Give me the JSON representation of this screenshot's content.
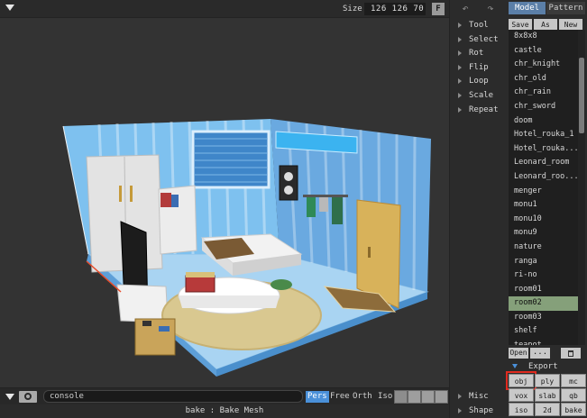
{
  "toolbar": {
    "size_label": "Size",
    "size_values": "126 126 70",
    "f_button": "F"
  },
  "tools": {
    "undo_icon": "undo-icon",
    "redo_icon": "redo-icon",
    "items": [
      "Tool",
      "Select",
      "Rot",
      "Flip",
      "Loop",
      "Scale",
      "Repeat",
      "Misc",
      "Shape"
    ]
  },
  "tabs": {
    "model": "Model",
    "pattern": "Pattern"
  },
  "actions": {
    "save": "Save",
    "as": "As",
    "new": "New"
  },
  "files": [
    "8x8x8",
    "castle",
    "chr_knight",
    "chr_old",
    "chr_rain",
    "chr_sword",
    "doom",
    "Hotel_rouka_1",
    "Hotel_rouka...",
    "Leonard_room",
    "Leonard_roo...",
    "menger",
    "monu1",
    "monu10",
    "monu9",
    "nature",
    "ranga",
    "ri-no",
    "room01",
    "room02",
    "room03",
    "shelf",
    "teapot"
  ],
  "selected_file": "room02",
  "file_actions": {
    "open": "Open",
    "dots": "..."
  },
  "export": {
    "header": "Export",
    "buttons": [
      "obj",
      "ply",
      "mc",
      "vox",
      "slab",
      "qb",
      "iso",
      "2d",
      "bake"
    ]
  },
  "bottom": {
    "console_value": "console",
    "view_modes": [
      "Pers",
      "Free",
      "Orth",
      "Iso"
    ],
    "active_view_mode": "Pers"
  },
  "status": "bake : Bake Mesh",
  "colors": {
    "accent_blue": "#4a90d9",
    "tab_model": "#5b7fa8",
    "selected_row": "#85a07a",
    "highlight_red": "#e02a1f",
    "wall_blue": "#6fb6ec"
  }
}
